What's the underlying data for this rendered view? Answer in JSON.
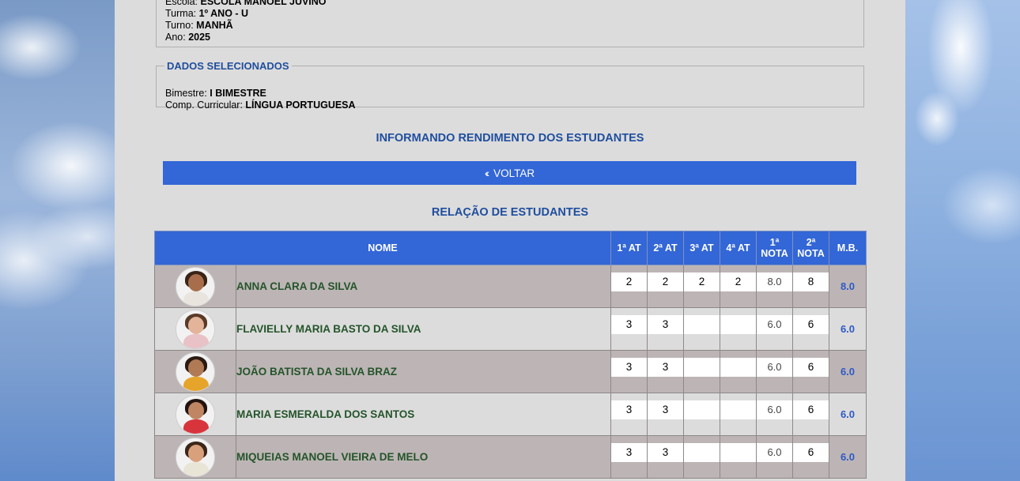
{
  "school_info": {
    "escola_label": "Escola:",
    "escola_value": "ESCOLA MANOEL JUVINO",
    "turma_label": "Turma:",
    "turma_value": "1º ANO - U",
    "turno_label": "Turno:",
    "turno_value": "MANHÃ",
    "ano_label": "Ano:",
    "ano_value": "2025"
  },
  "selected": {
    "legend": "DADOS SELECIONADOS",
    "bimestre_label": "Bimestre:",
    "bimestre_value": "I BIMESTRE",
    "comp_label": "Comp. Curricular:",
    "comp_value": "LÍNGUA PORTUGUESA"
  },
  "page_title": "INFORMANDO RENDIMENTO DOS ESTUDANTES",
  "back_button": {
    "icon": "chevrons-left-icon",
    "label": "VOLTAR"
  },
  "list_title": "RELAÇÃO DE ESTUDANTES",
  "table": {
    "headers": {
      "nome": "NOME",
      "at1": "1ª AT",
      "at2": "2ª AT",
      "at3": "3ª AT",
      "at4": "4ª AT",
      "nota1_line1": "1ª",
      "nota1_line2": "NOTA",
      "nota2_line1": "2ª",
      "nota2_line2": "NOTA",
      "mb": "M.B."
    },
    "rows": [
      {
        "name": "ANNA CLARA DA SILVA",
        "at1": "2",
        "at2": "2",
        "at3": "2",
        "at4": "2",
        "nota1": "8.0",
        "nota2": "8",
        "mb": "8.0"
      },
      {
        "name": "FLAVIELLY MARIA BASTO DA SILVA",
        "at1": "3",
        "at2": "3",
        "at3": "",
        "at4": "",
        "nota1": "6.0",
        "nota2": "6",
        "mb": "6.0"
      },
      {
        "name": "JOÃO BATISTA DA SILVA BRAZ",
        "at1": "3",
        "at2": "3",
        "at3": "",
        "at4": "",
        "nota1": "6.0",
        "nota2": "6",
        "mb": "6.0"
      },
      {
        "name": "MARIA ESMERALDA DOS SANTOS",
        "at1": "3",
        "at2": "3",
        "at3": "",
        "at4": "",
        "nota1": "6.0",
        "nota2": "6",
        "mb": "6.0"
      },
      {
        "name": "MIQUEIAS MANOEL VIEIRA DE MELO",
        "at1": "3",
        "at2": "3",
        "at3": "",
        "at4": "",
        "nota1": "6.0",
        "nota2": "6",
        "mb": "6.0"
      }
    ]
  },
  "colors": {
    "accent_blue": "#3366d6",
    "title_blue": "#1f4e9e",
    "name_green": "#24542a",
    "row_dark": "#bdb5b5",
    "row_light": "#dcdcdc"
  }
}
